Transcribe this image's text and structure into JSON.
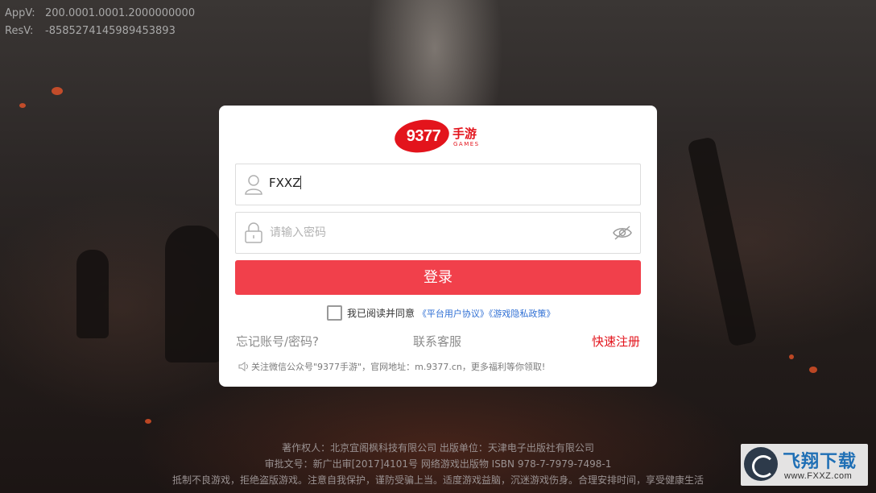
{
  "debug": {
    "app_version_label": "AppV:",
    "app_version": "200.0001.0001.2000000000",
    "res_version_label": "ResV:",
    "res_version": "-8585274145989453893"
  },
  "logo": {
    "number": "9377",
    "cn": "手游",
    "en": "GAMES"
  },
  "login": {
    "username_value": "FXXZ",
    "password_placeholder": "请输入密码",
    "submit_label": "登录",
    "agree_text": "我已阅读并同意",
    "agreement_link": "《平台用户协议》",
    "privacy_link": "《游戏隐私政策》",
    "forgot_label": "忘记账号/密码?",
    "service_label": "联系客服",
    "register_label": "快速注册",
    "notice": "关注微信公众号\"9377手游\"，官网地址：m.9377.cn，更多福利等你领取!"
  },
  "footer": {
    "line1": "著作权人：北京宜阁枫科技有限公司 出版单位：天津电子出版社有限公司",
    "line2": "审批文号：新广出审[2017]4101号 网络游戏出版物 ISBN 978-7-7979-7498-1",
    "line3": "抵制不良游戏，拒绝盗版游戏。注意自我保护，谨防受骗上当。适度游戏益脑，沉迷游戏伤身。合理安排时间，享受健康生活"
  },
  "watermark": {
    "title": "飞翔下载",
    "url": "www.FXXZ.com"
  },
  "colors": {
    "primary": "#f1404b",
    "brand_red": "#e3141c",
    "link_blue": "#2f6fd4"
  }
}
